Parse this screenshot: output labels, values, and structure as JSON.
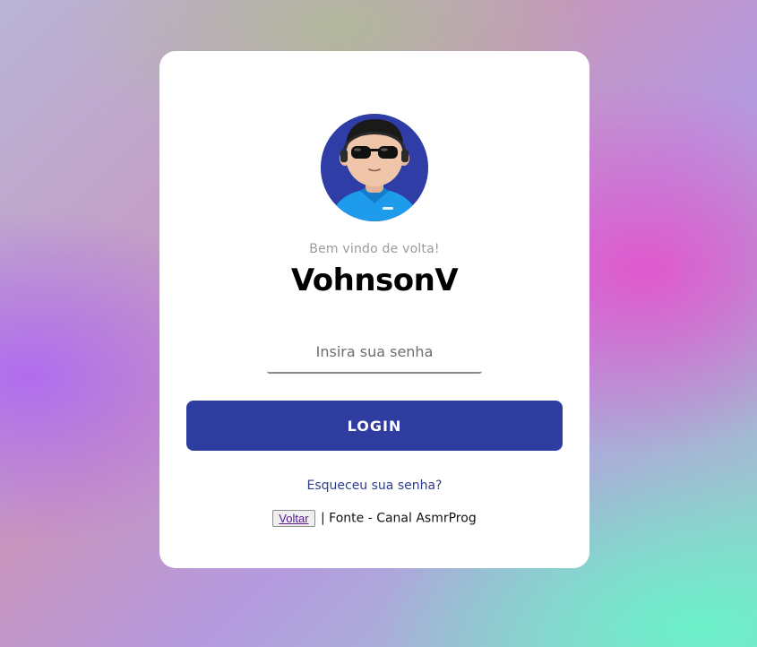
{
  "login_card": {
    "welcome_text": "Bem vindo de volta!",
    "username": "VohnsonV",
    "password": {
      "placeholder": "Insira sua senha",
      "value": ""
    },
    "login_button_label": "LOGIN",
    "forgot_password_label": "Esqueceu sua senha?",
    "footer": {
      "back_button_label": "Voltar",
      "source_text": "| Fonte - Canal AsmrProg"
    },
    "avatar_icon": "avatar-3d-character-sunglasses"
  },
  "colors": {
    "accent": "#2f3da0",
    "card_background": "#ffffff",
    "link": "#2f3d8f",
    "muted_text": "#9a9a9a"
  }
}
